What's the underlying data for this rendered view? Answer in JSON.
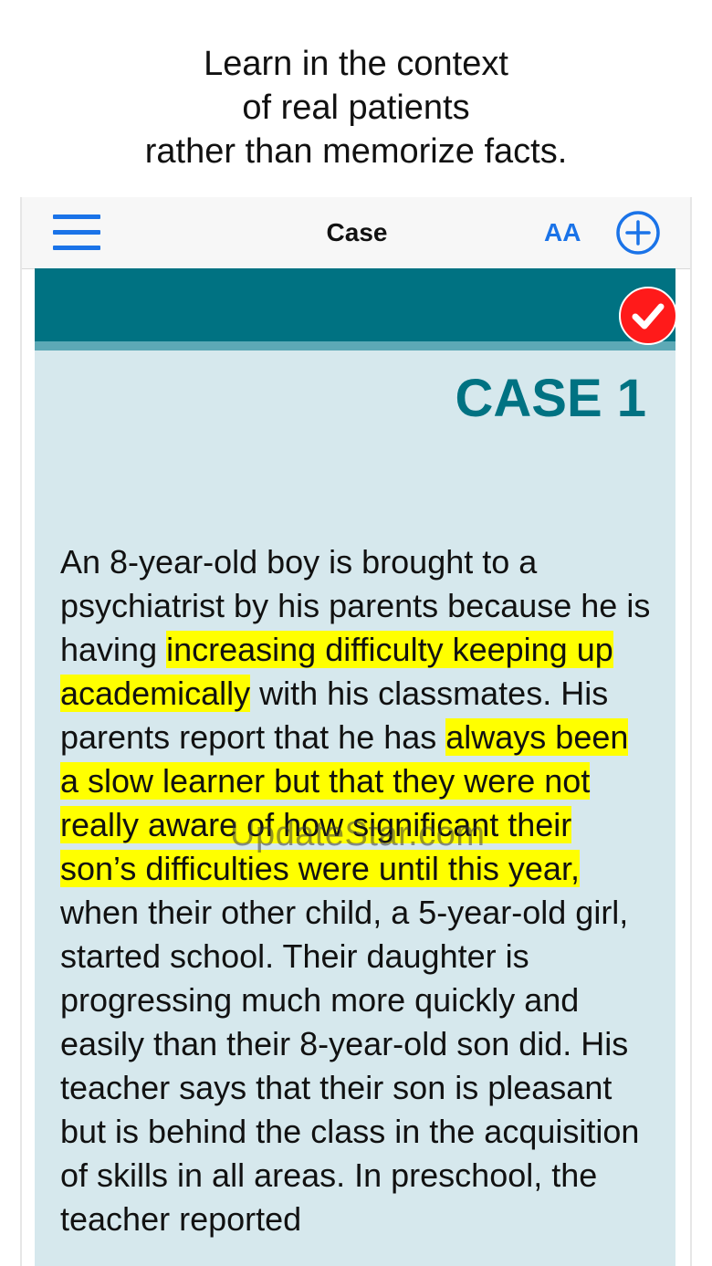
{
  "promo": {
    "line1": "Learn in the context",
    "line2": "of real patients",
    "line3": "rather than memorize facts."
  },
  "navbar": {
    "menu_icon": "hamburger-menu-icon",
    "title": "Case",
    "font_size_label": "AA",
    "add_icon": "plus-circle-icon"
  },
  "case": {
    "completed_icon": "checkmark-badge-icon",
    "title": "CASE 1",
    "segments": [
      {
        "text": "An 8-year-old boy is brought to a psychiatrist by his parents because he is having ",
        "highlight": false
      },
      {
        "text": "increasing difficulty keeping up academically",
        "highlight": true
      },
      {
        "text": " with his classmates. His parents report that he has ",
        "highlight": false
      },
      {
        "text": "always been a slow learner but that they were not really aware of how significant their son’s difficulties were until this year,",
        "highlight": true
      },
      {
        "text": " when their other child, a 5-year-old girl, started school. Their daughter is progressing much more quickly and easily than their 8-year-old son did. His teacher says that their son is pleasant but is behind the class in the acquisition of skills in all areas. In preschool, the teacher reported",
        "highlight": false
      }
    ]
  },
  "watermark": "UpdateStar.com",
  "colors": {
    "accent_blue": "#1a73e8",
    "banner_teal": "#007282",
    "content_bg": "#d6e8ed",
    "highlight": "#ffff00",
    "badge_red": "#ff1a1a"
  }
}
